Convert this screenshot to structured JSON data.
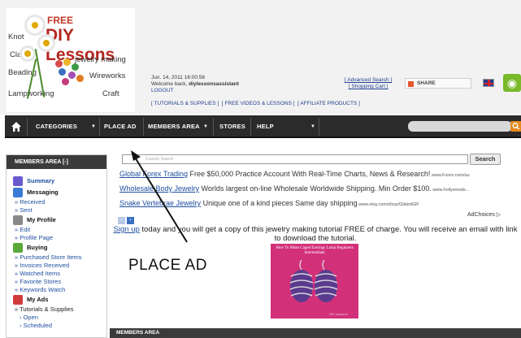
{
  "logo": {
    "free": "FREE",
    "title": "DIY Lessons",
    "words": {
      "knot": "Knot",
      "clay": "Clay",
      "jewelry": "jewelry making",
      "beading": "Beading",
      "wireworks": "Wireworks",
      "lampworking": "Lampworking",
      "craft": "Craft"
    }
  },
  "header": {
    "datetime": "Jun. 14, 2011 16:00:56",
    "welcome": "Welcome back, ",
    "username": "diylessonsassistant",
    "logout": "LOGOUT",
    "toplinks": [
      "[ TUTORIALS & SUPPLIES ]",
      "[ FREE VIDEOS & LESSONS ]",
      "[ AFFILIATE PRODUCTS ]"
    ],
    "advanced_search": "[ Advanced Search ]",
    "shopping_cart": "[ Shopping Cart ]",
    "share": "SHARE"
  },
  "nav": {
    "items": [
      "CATEGORIES",
      "PLACE AD",
      "MEMBERS AREA",
      "STORES",
      "HELP"
    ]
  },
  "sidebar": {
    "title": "MEMBERS AREA [-]",
    "summary": "Summary",
    "messaging": "Messaging",
    "received": "» Received",
    "sent": "» Sent",
    "my_profile": "My Profile",
    "edit": "» Edit",
    "profile_page": "» Profile Page",
    "buying": "Buying",
    "purchased": "» Purchased Store Items",
    "invoices": "» Invoices Received",
    "watched": "» Watched Items",
    "favorite": "» Favorite Stores",
    "keywords": "» Keywords Watch",
    "my_ads": "My Ads",
    "tutorials": "» Tutorials & Supplies",
    "open": "› Open",
    "scheduled": "› Scheduled"
  },
  "main": {
    "custom_search_placeholder": "Custom Search",
    "search_button": "Search",
    "ads": [
      {
        "title": "Global Forex Trading",
        "text": " Free $50,000 Practice Account With Real-Time Charts, News & Research!",
        "url": " www.Forex.com/au"
      },
      {
        "title": "Wholesale Body Jewelry",
        "text": " Worlds largest on-line Wholesale Worldwide Shipping. Min Order $100.",
        "url": " www.hollywoods..."
      },
      {
        "title": "Snake Vertebrae Jewelry",
        "text": " Unique one of a kind pieces Same day shipping",
        "url": " www.etsy.com/shop/GildedGR"
      }
    ],
    "adchoices": "AdChoices ▷",
    "signup_link": "Sign up",
    "signup_text": " today and you will get a copy of this jewelry making tutorial FREE of charge. You will receive an email with link to download the tutorial.",
    "tutorial_title": "How To Make Caged Earrings Lamp Beginners Intermediate",
    "tutorial_foot": "DIY Lessons",
    "members_area": "MEMBERS AREA"
  },
  "annotation": {
    "label": "PLACE AD"
  }
}
